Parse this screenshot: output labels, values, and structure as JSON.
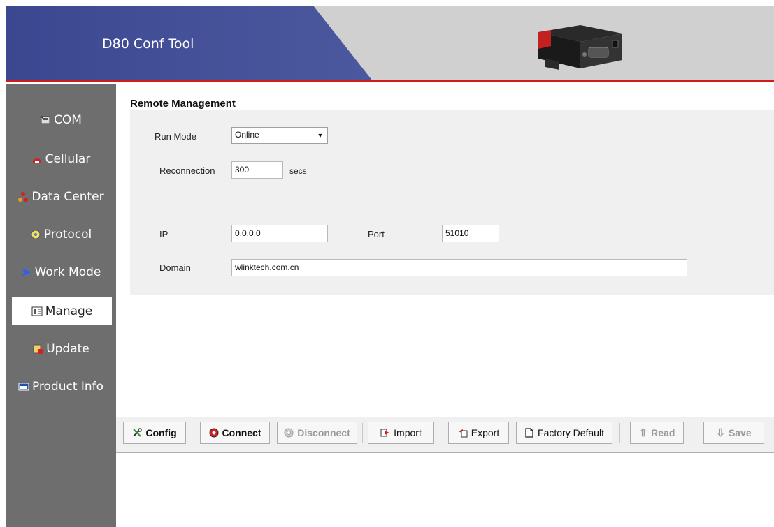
{
  "app": {
    "title": "D80 Conf Tool"
  },
  "sidebar": {
    "items": [
      {
        "label": "COM",
        "icon": "com-icon"
      },
      {
        "label": "Cellular",
        "icon": "phone-icon"
      },
      {
        "label": "Data Center",
        "icon": "network-icon"
      },
      {
        "label": "Protocol",
        "icon": "protocol-icon"
      },
      {
        "label": "Work Mode",
        "icon": "arrow-icon"
      },
      {
        "label": "Manage",
        "icon": "manage-icon",
        "active": true
      },
      {
        "label": "Update",
        "icon": "update-icon"
      },
      {
        "label": "Product Info",
        "icon": "product-info-icon"
      }
    ]
  },
  "main": {
    "section_title": "Remote Management",
    "run_mode": {
      "label": "Run Mode",
      "value": "Online"
    },
    "reconnection": {
      "label": "Reconnection",
      "value": "300",
      "unit": "secs"
    },
    "ip": {
      "label": "IP",
      "value": "0.0.0.0"
    },
    "port": {
      "label": "Port",
      "value": "51010"
    },
    "domain": {
      "label": "Domain",
      "value": "wlinktech.com.cn"
    }
  },
  "toolbar": {
    "config": "Config",
    "connect": "Connect",
    "disconnect": "Disconnect",
    "import": "Import",
    "export": "Export",
    "factory_default": "Factory Default",
    "read": "Read",
    "save": "Save"
  },
  "colors": {
    "header_blue": "#3b4790",
    "accent_red": "#d11a1a",
    "sidebar_gray": "#6e6e6e"
  }
}
